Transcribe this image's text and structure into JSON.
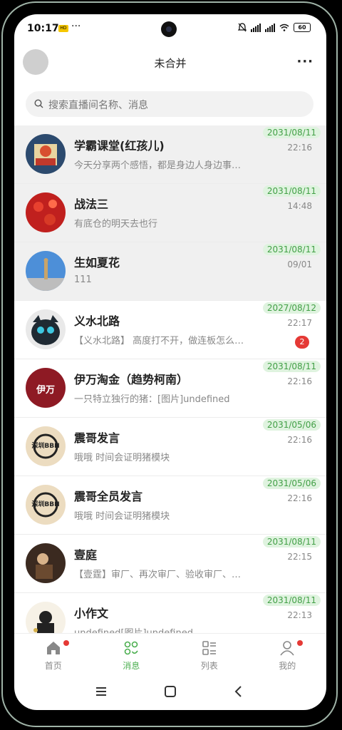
{
  "status": {
    "time": "10:17",
    "badge": "HD",
    "dots": "···",
    "battery": "60"
  },
  "header": {
    "title": "未合并",
    "more": "···"
  },
  "search": {
    "placeholder": "搜索直播间名称、消息"
  },
  "conversations": [
    {
      "name": "学霸课堂(红孩儿)",
      "message": "今天分享两个感悟，都是身边人身边事…",
      "date": "2031/08/11",
      "time": "22:16",
      "pinned": true,
      "avatar": "avatar-xueba"
    },
    {
      "name": "战法三",
      "message": "有底仓的明天去也行",
      "date": "2031/08/11",
      "time": "14:48",
      "pinned": true,
      "avatar": "avatar-zhanfa"
    },
    {
      "name": "生如夏花",
      "message": "111",
      "date": "2031/08/11",
      "time": "09/01",
      "pinned": true,
      "avatar": "avatar-shengru"
    },
    {
      "name": "义水北路",
      "message": "【义水北路】 高度打不开，做连板怎么…",
      "date": "2027/08/12",
      "time": "22:17",
      "unread": "2",
      "avatar": "avatar-yishui"
    },
    {
      "name": "伊万淘金（趋势柯南）",
      "message": "一只特立独行的猪：[图片]undefined",
      "date": "2031/08/11",
      "time": "22:16",
      "avatar": "avatar-yiwan",
      "avatar_text": "伊万"
    },
    {
      "name": "震哥发言",
      "message": "哦哦 时间会证明猪模块",
      "date": "2031/05/06",
      "time": "22:16",
      "avatar": "avatar-zhenge",
      "avatar_text": "深圳BBH"
    },
    {
      "name": "震哥全员发言",
      "message": "哦哦 时间会证明猪模块",
      "date": "2031/05/06",
      "time": "22:16",
      "avatar": "avatar-zhenge-all",
      "avatar_text": "深圳BBH"
    },
    {
      "name": "壹庭",
      "message": "【壹霆】审厂、再次审厂、验收审厂、…",
      "date": "2031/08/11",
      "time": "22:15",
      "avatar": "avatar-yiting"
    },
    {
      "name": "小作文",
      "message": "undefined[图片]undefined",
      "date": "2031/08/11",
      "time": "22:13",
      "avatar": "avatar-xiaozuowen"
    }
  ],
  "tabs": [
    {
      "label": "首页",
      "icon": "home-icon",
      "dot": true
    },
    {
      "label": "消息",
      "icon": "message-icon",
      "active": true
    },
    {
      "label": "列表",
      "icon": "list-icon"
    },
    {
      "label": "我的",
      "icon": "profile-icon",
      "dot": true
    }
  ],
  "colors": {
    "accent": "#4caf50",
    "date_bg": "#dff3df",
    "unread": "#e53935"
  }
}
